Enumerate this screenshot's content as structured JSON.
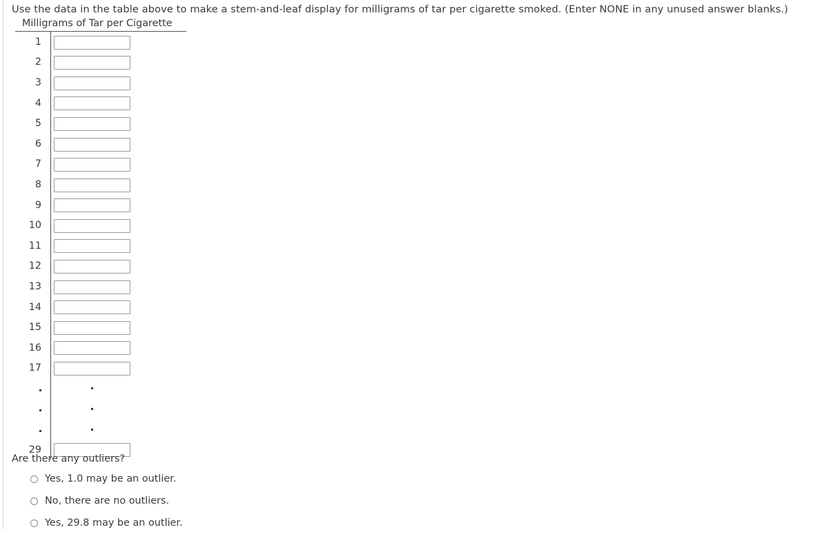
{
  "prompt": "Use the data in the table above to make a stem-and-leaf display for milligrams of tar per cigarette smoked. (Enter NONE in any unused answer blanks.)",
  "table": {
    "caption": "Milligrams of Tar per Cigarette",
    "rows": [
      {
        "stem": "1",
        "value": "",
        "placeholder": ""
      },
      {
        "stem": "2",
        "value": "",
        "placeholder": ""
      },
      {
        "stem": "3",
        "value": "",
        "placeholder": ""
      },
      {
        "stem": "4",
        "value": "",
        "placeholder": ""
      },
      {
        "stem": "5",
        "value": "",
        "placeholder": ""
      },
      {
        "stem": "6",
        "value": "",
        "placeholder": ""
      },
      {
        "stem": "7",
        "value": "",
        "placeholder": ""
      },
      {
        "stem": "8",
        "value": "",
        "placeholder": ""
      },
      {
        "stem": "9",
        "value": "",
        "placeholder": ""
      },
      {
        "stem": "10",
        "value": "",
        "placeholder": ""
      },
      {
        "stem": "11",
        "value": "",
        "placeholder": ""
      },
      {
        "stem": "12",
        "value": "",
        "placeholder": ""
      },
      {
        "stem": "13",
        "value": "",
        "placeholder": ""
      },
      {
        "stem": "14",
        "value": "",
        "placeholder": ""
      },
      {
        "stem": "15",
        "value": "",
        "placeholder": ""
      },
      {
        "stem": "16",
        "value": "",
        "placeholder": ""
      },
      {
        "stem": "17",
        "value": "",
        "placeholder": ""
      }
    ],
    "ellipsis_rows": 3,
    "last_row": {
      "stem": "29",
      "value": "",
      "placeholder": ""
    }
  },
  "outliers": {
    "question": "Are there any outliers?",
    "options": [
      {
        "label": "Yes, 1.0 may be an outlier.",
        "selected": false
      },
      {
        "label": "No, there are no outliers.",
        "selected": false
      },
      {
        "label": "Yes, 29.8 may be an outlier.",
        "selected": false
      }
    ]
  },
  "colors": {
    "text": "#3a3a3a",
    "input_border": "#9a9a9a",
    "divider": "#4a4a4a",
    "page_rule": "#d6d6d6",
    "background": "#ffffff"
  }
}
